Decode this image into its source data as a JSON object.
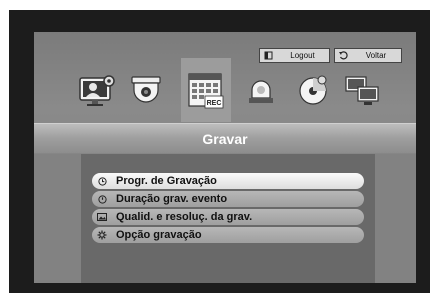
{
  "top_bar": {
    "logout_label": "Logout",
    "voltar_label": "Voltar"
  },
  "toolbar_icons": [
    {
      "name": "display-setup-icon"
    },
    {
      "name": "camera-icon"
    },
    {
      "name": "record-icon",
      "badge": "REC",
      "selected": true
    },
    {
      "name": "event-alarm-icon"
    },
    {
      "name": "backup-disc-icon"
    },
    {
      "name": "network-icon"
    }
  ],
  "section": {
    "title": "Gravar"
  },
  "menu": {
    "items": [
      {
        "label": "Progr. de Gravação",
        "icon": "clock-icon",
        "active": true
      },
      {
        "label": "Duração grav. evento",
        "icon": "timer-icon",
        "active": false
      },
      {
        "label": "Qualid. e resoluç. da grav.",
        "icon": "image-icon",
        "active": false
      },
      {
        "label": "Opção gravação",
        "icon": "gear-icon",
        "active": false
      }
    ]
  },
  "colors": {
    "frame": "#1c1c1c",
    "screen": "#7b7b7b",
    "title_text": "#ffffff",
    "active_item": "#f5f5f5"
  }
}
